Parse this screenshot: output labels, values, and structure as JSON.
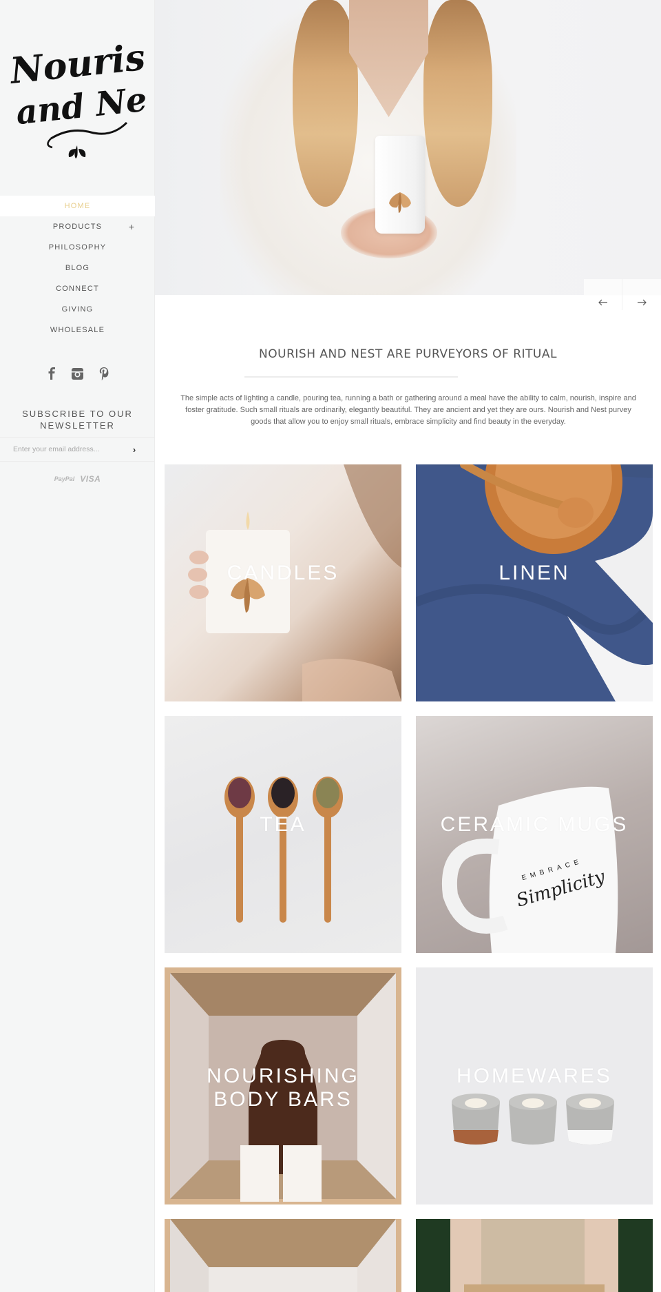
{
  "brand": {
    "logo_text_line1": "Nourish",
    "logo_text_line2": "and Nest",
    "logo_icon": "lotus-flourish-icon"
  },
  "sidebar": {
    "nav": [
      {
        "label": "HOME",
        "active": true
      },
      {
        "label": "PRODUCTS",
        "expandable": true,
        "expand_icon": "+"
      },
      {
        "label": "PHILOSOPHY"
      },
      {
        "label": "BLOG"
      },
      {
        "label": "CONNECT"
      },
      {
        "label": "GIVING"
      },
      {
        "label": "WHOLESALE"
      }
    ],
    "social": [
      {
        "name": "facebook-icon",
        "glyph": "f"
      },
      {
        "name": "instagram-icon",
        "glyph": "instagram"
      },
      {
        "name": "pinterest-icon",
        "glyph": "P"
      }
    ],
    "newsletter": {
      "title": "SUBSCRIBE TO OUR NEWSLETTER",
      "email_placeholder": "Enter your email address...",
      "email_value": "",
      "submit_glyph": "›"
    },
    "payments": [
      "PayPal",
      "VISA"
    ]
  },
  "hero": {
    "alt": "Woman in white dress holding a white candle with a gold flower motif",
    "prev_glyph": "←",
    "next_glyph": "→"
  },
  "intro": {
    "title": "NOURISH AND NEST ARE PURVEYORS OF RITUAL",
    "text": "The simple acts of lighting a candle, pouring tea, running a bath or gathering around a meal have the ability to calm, nourish, inspire and foster gratitude. Such small rituals are ordinarily, elegantly beautiful. They are ancient and yet they are ours. Nourish and Nest purvey goods that allow you to enjoy small rituals, embrace simplicity and find beauty in the everyday."
  },
  "categories": [
    {
      "label": "CANDLES"
    },
    {
      "label": "LINEN"
    },
    {
      "label": "TEA"
    },
    {
      "label": "CERAMIC MUGS",
      "mug_text_top": "EMBRACE",
      "mug_text_script": "Simplicity"
    },
    {
      "label_line1": "NOURISHING",
      "label_line2": "BODY BARS"
    },
    {
      "label": "HOMEWARES"
    },
    {
      "label": ""
    },
    {
      "label": ""
    }
  ],
  "colors": {
    "accent_active_nav": "#e8cf8e",
    "sidebar_bg": "#f5f6f6",
    "text": "#555555"
  }
}
